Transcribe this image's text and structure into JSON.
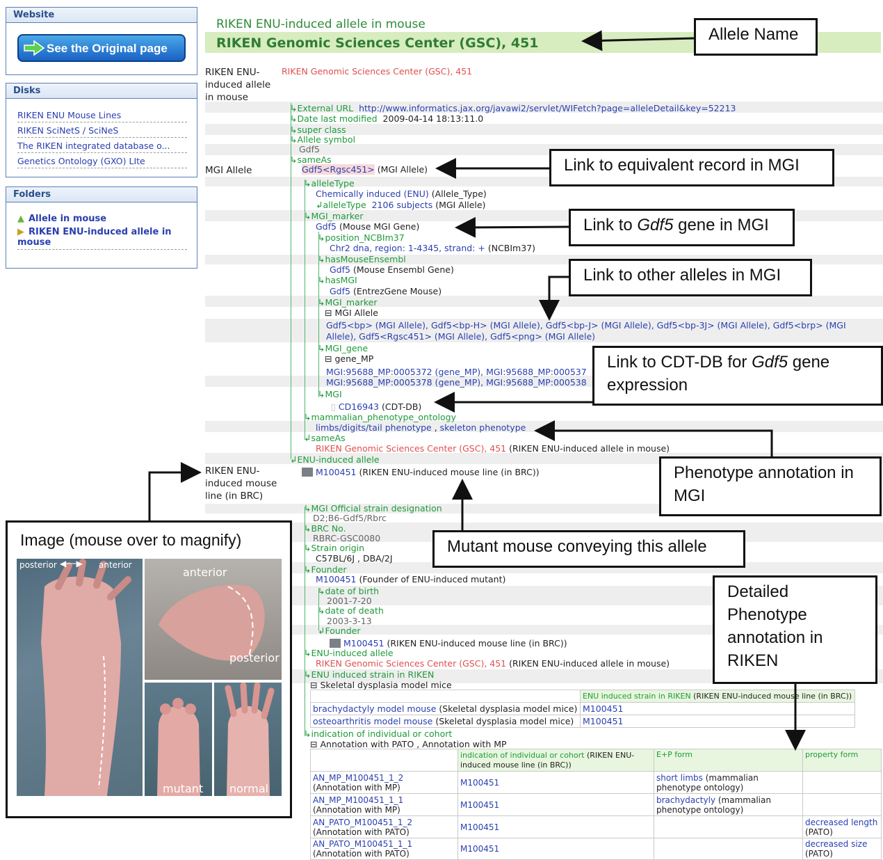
{
  "sidebar": {
    "website": {
      "title": "Website",
      "button": "See the Original page"
    },
    "disks": {
      "title": "Disks",
      "items": [
        "RIKEN ENU Mouse Lines",
        "RIKEN SciNetS / SciNeS",
        "The RIKEN integrated database o...",
        "Genetics Ontology (GXO) LIte"
      ]
    },
    "folders": {
      "title": "Folders",
      "items": [
        "Allele in mouse",
        "RIKEN ENU-induced allele in mouse"
      ]
    }
  },
  "header": {
    "class": "RIKEN ENU-induced allele in mouse",
    "title": "RIKEN Genomic Sciences Center (GSC), 451"
  },
  "rows": {
    "top_label": "RIKEN ENU-induced allele in mouse",
    "top_value": "RIKEN Genomic Sciences Center (GSC), 451",
    "external_url_label": "External URL",
    "external_url": "http://www.informatics.jax.org/javawi2/servlet/WIFetch?page=alleleDetail&key=52213",
    "date_label": "Date last modified",
    "date": "2009-04-14 18:13:11.0",
    "super_class": "super class",
    "allele_symbol_label": "Allele symbol",
    "allele_symbol": "Gdf5",
    "sameas": "sameAs",
    "mgi_allele_label": "MGI Allele",
    "mgi_allele_link": "Gdf5<Rgsc451>",
    "mgi_allele_suffix": "(MGI Allele)",
    "alleletype": "alleleType",
    "chem": "Chemically induced (ENU)",
    "chem_suffix": "(Allele_Type)",
    "alleletype2": "alleleType",
    "subjects": "2106 subjects",
    "subjects_suffix": "(MGI Allele)",
    "mgi_marker": "MGI_marker",
    "gdf5": "Gdf5",
    "gdf5_suffix": "(Mouse MGI Gene)",
    "position": "position_NCBIm37",
    "chr": "Chr2 dna, region: 1-4345, strand: +",
    "chr_suffix": "(NCBIm37)",
    "ensembl": "hasMouseEnsembl",
    "ensembl_gene": "Gdf5",
    "ensembl_suffix": "(Mouse Ensembl Gene)",
    "hasmgi": "hasMGI",
    "entrez_gene": "Gdf5",
    "entrez_suffix": "(EntrezGene Mouse)",
    "mgi_marker2": "MGI_marker",
    "mgi_allele_tree": "MGI Allele",
    "alleles_line1": "Gdf5<bp> (MGI Allele), Gdf5<bp-H> (MGI Allele), Gdf5<bp-J> (MGI Allele), Gdf5<bp-3J> (MGI Allele), Gdf5<brp> (MGI",
    "alleles_line2": "Allele), Gdf5<Rgsc451> (MGI Allele), Gdf5<png> (MGI Allele)",
    "mgi_gene": "MGI_gene",
    "gene_mp": "gene_MP",
    "mp1": "MGI:95688_MP:0005372 (gene_MP), MGI:95688_MP:000537",
    "mp2": "MGI:95688_MP:0005378 (gene_MP), MGI:95688_MP:000538",
    "mgi": "MGI",
    "cd": "CD16943",
    "cd_suffix": "(CDT-DB)",
    "mpo": "mammalian_phenotype_ontology",
    "pheno1": "limbs/digits/tail phenotype",
    "pheno2": "skeleton phenotype",
    "sameas2": "sameAs",
    "gsc451": "RIKEN Genomic Sciences Center (GSC), 451",
    "gsc451_suffix": "(RIKEN ENU-induced allele in mouse)",
    "enu_allele": "ENU-induced allele",
    "line_label": "RIKEN ENU-induced mouse line (in BRC)",
    "m100451": "M100451",
    "m100451_suffix": "(RIKEN ENU-induced mouse line (in BRC))",
    "official": "MGI Official strain designation",
    "official_val": "D2;B6-Gdf5/Rbrc",
    "brc": "BRC No.",
    "brc_val": "RBRC-GSC0080",
    "strain": "Strain origin",
    "strain_val": "C57BL/6J , DBA/2J",
    "founder": "Founder",
    "founder_val": "M100451",
    "founder_suffix": "(Founder of ENU-induced mutant)",
    "dob": "date of birth",
    "dob_val": "2001-7-20",
    "dod": "date of death",
    "dod_val": "2003-3-13",
    "founder2": "Founder",
    "founder2_val": "M100451",
    "founder2_suffix": "(RIKEN ENU-induced mouse line (in BRC))",
    "enu_allele2": "ENU-induced allele",
    "gsc451b": "RIKEN Genomic Sciences Center (GSC), 451",
    "gsc451b_suffix": "(RIKEN ENU-induced allele in mouse)",
    "enu_strain": "ENU induced strain in RIKEN",
    "skeletal": "Skeletal dysplasia model mice",
    "indication": "indication of individual or cohort",
    "annot": "Annotation with PATO , Annotation with MP"
  },
  "strain_table": {
    "header": "ENU induced strain in RIKEN",
    "header_suffix": "(RIKEN ENU-induced mouse line (in BRC))",
    "rows": [
      {
        "name": "brachydactyly model mouse",
        "suffix": "(Skeletal dysplasia model mice)",
        "id": "M100451"
      },
      {
        "name": "osteoarthritis model mouse",
        "suffix": "(Skeletal dysplasia model mice)",
        "id": "M100451"
      }
    ]
  },
  "annot_table": {
    "headers": [
      "indication of individual or cohort",
      "(RIKEN ENU-induced mouse line (in BRC))",
      "E+P form",
      "property form"
    ],
    "rows": [
      {
        "id": "AN_MP_M100451_1_2",
        "type": "(Annotation with MP)",
        "ind": "M100451",
        "ep": "short limbs",
        "ep_suffix": "(mammalian phenotype ontology)",
        "prop": "",
        "prop_suffix": ""
      },
      {
        "id": "AN_MP_M100451_1_1",
        "type": "(Annotation with MP)",
        "ind": "M100451",
        "ep": "brachydactyly",
        "ep_suffix": "(mammalian phenotype ontology)",
        "prop": "",
        "prop_suffix": ""
      },
      {
        "id": "AN_PATO_M100451_1_2",
        "type": "(Annotation with PATO)",
        "ind": "M100451",
        "ep": "",
        "ep_suffix": "",
        "prop": "decreased length",
        "prop_suffix": "(PATO)"
      },
      {
        "id": "AN_PATO_M100451_1_1",
        "type": "(Annotation with PATO)",
        "ind": "M100451",
        "ep": "",
        "ep_suffix": "",
        "prop": "decreased size",
        "prop_suffix": "(PATO)"
      }
    ]
  },
  "callouts": {
    "allele_name": "Allele Name",
    "equiv_mgi": "Link to equivalent record in MGI",
    "gdf5_gene_pre": "Link to ",
    "gdf5_gene_it": "Gdf5",
    "gdf5_gene_post": " gene in MGI",
    "other_alleles": "Link to other alleles in MGI",
    "cdt_pre": "Link to CDT-DB for ",
    "cdt_it": "Gdf5",
    "cdt_post": " gene expression",
    "phenotype_mgi": "Phenotype annotation in MGI",
    "mutant_mouse": "Mutant mouse conveying this allele",
    "detailed": "Detailed Phenotype annotation in RIKEN",
    "image": "Image (mouse over to magnify)"
  },
  "image_labels": {
    "posterior": "posterior",
    "anterior": "anterior",
    "anterior2": "anterior",
    "posterior2": "posterior",
    "mutant": "mutant",
    "normal": "normal"
  }
}
